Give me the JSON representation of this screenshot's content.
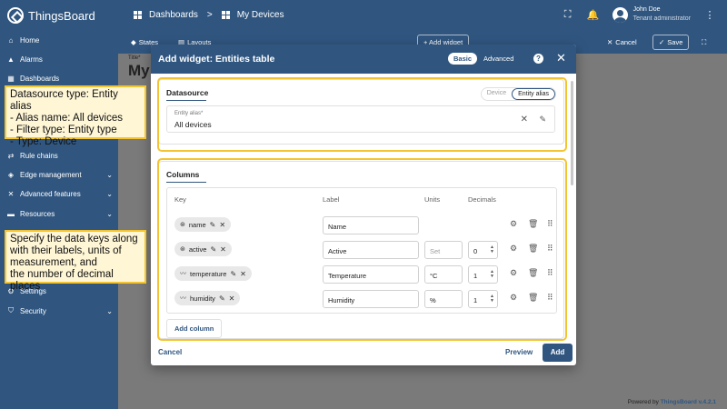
{
  "app": {
    "logo_text": "ThingsBoard",
    "breadcrumb": {
      "first": "Dashboards",
      "separator": ">",
      "second": "My Devices"
    },
    "user": {
      "name": "John Doe",
      "role": "Tenant administrator"
    }
  },
  "sidebar": {
    "items": [
      {
        "label": "Home",
        "icon": "home-icon"
      },
      {
        "label": "Alarms",
        "icon": "alarm-icon"
      },
      {
        "label": "Dashboards",
        "icon": "dashboard-icon"
      },
      {
        "label": "Rule chains",
        "icon": "rule-chain-icon"
      },
      {
        "label": "Edge management",
        "icon": "edge-icon",
        "expandable": true
      },
      {
        "label": "Advanced features",
        "icon": "tools-icon",
        "expandable": true
      },
      {
        "label": "Resources",
        "icon": "folder-icon",
        "expandable": true
      },
      {
        "label": "Settings",
        "icon": "gear-icon"
      },
      {
        "label": "Security",
        "icon": "shield-icon",
        "expandable": true
      }
    ]
  },
  "dashboard": {
    "toolbar": {
      "states": "States",
      "layouts": "Layouts",
      "add_widget": "+ Add widget",
      "cancel": "Cancel",
      "save": "Save"
    },
    "title_small": "Title*",
    "title_big": "My",
    "powered_prefix": "Powered by ",
    "powered_brand": "ThingsBoard v.4.2.1"
  },
  "dialog": {
    "title": "Add widget:  Entities table",
    "mode_basic": "Basic",
    "mode_advanced": "Advanced",
    "datasource": {
      "section_title": "Datasource",
      "type_device": "Device",
      "type_entity_alias": "Entity alias",
      "alias_label": "Entity alias*",
      "alias_value": "All devices"
    },
    "columns": {
      "section_title": "Columns",
      "headers": {
        "key": "Key",
        "label": "Label",
        "units": "Units",
        "decimals": "Decimals"
      },
      "rows": [
        {
          "key": "name",
          "key_icon": "attribute-icon",
          "label": "Name",
          "units": "",
          "decimals": ""
        },
        {
          "key": "active",
          "key_icon": "attribute-icon",
          "label": "Active",
          "units_placeholder": "Set",
          "decimals": "0"
        },
        {
          "key": "temperature",
          "key_icon": "timeseries-icon",
          "label": "Temperature",
          "units": "°C",
          "decimals": "1"
        },
        {
          "key": "humidity",
          "key_icon": "timeseries-icon",
          "label": "Humidity",
          "units": "%",
          "decimals": "1"
        }
      ],
      "add_column": "Add column"
    },
    "footer": {
      "cancel": "Cancel",
      "preview": "Preview",
      "add": "Add"
    }
  },
  "annotations": {
    "datasource_note": "Datasource type: Entity alias\n- Alias name: All devices\n- Filter type: Entity type\n- Type: Device",
    "columns_note": "Specify the data keys along\nwith their labels, units of\nmeasurement, and\nthe number of decimal places"
  },
  "colors": {
    "primary": "#305680",
    "highlight": "#f4c430",
    "callout_bg": "#fff6d6"
  }
}
